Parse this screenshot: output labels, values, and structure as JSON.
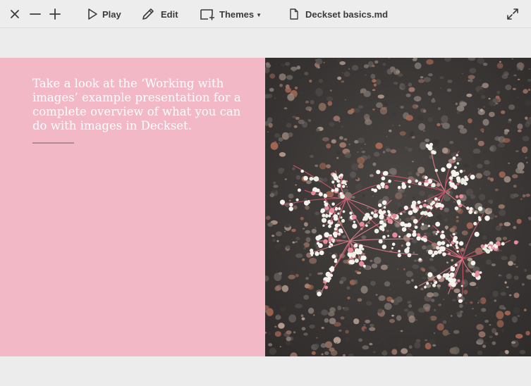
{
  "toolbar": {
    "close_icon": "close-icon",
    "zoom_out_icon": "minus-icon",
    "zoom_in_icon": "plus-icon",
    "play_label": "Play",
    "edit_label": "Edit",
    "themes_label": "Themes",
    "file_name": "Deckset basics.md",
    "fullscreen_icon": "expand-icon"
  },
  "slide": {
    "background_color": "#f2b8c6",
    "text": "Take a look at the ‘Working with images’ example presentation for a complete overview of what you can do with images in Deckset.",
    "image_description_icon": "photo-flowers-on-gravel"
  }
}
